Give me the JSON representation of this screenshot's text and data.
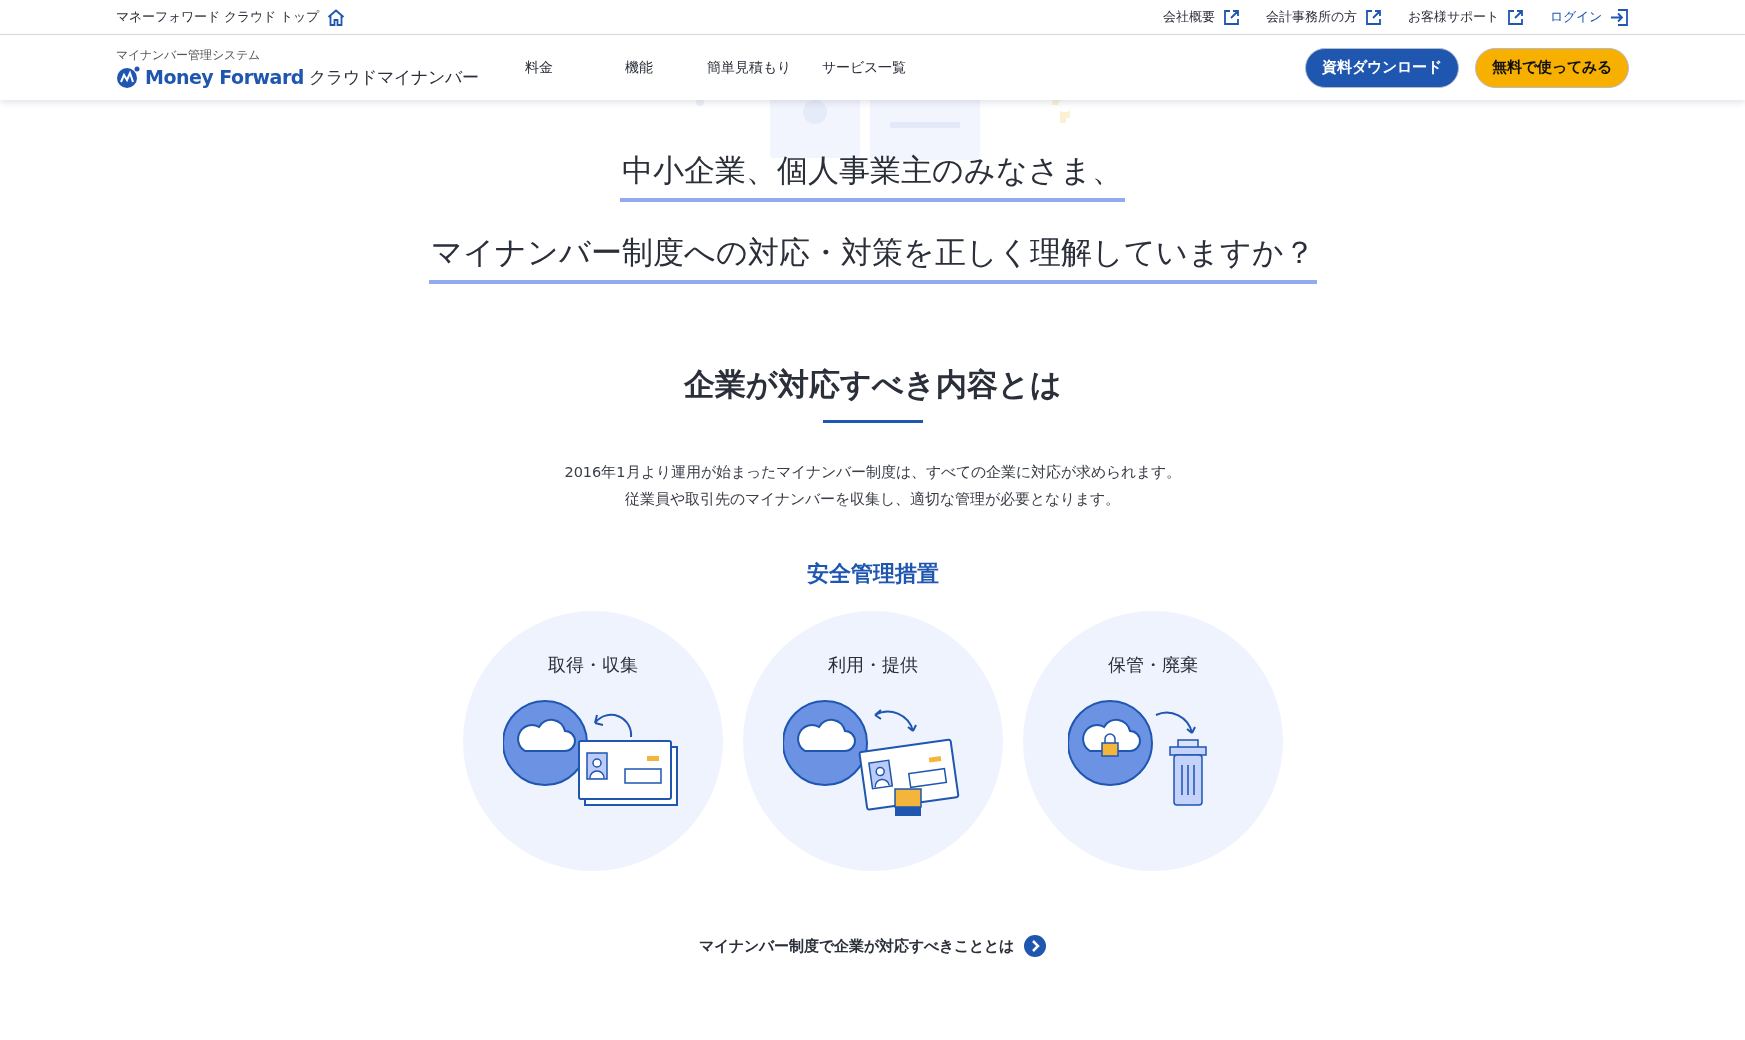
{
  "top_bar": {
    "home_link": "マネーフォワード クラウド トップ",
    "links": [
      {
        "label": "会社概要",
        "kind": "external"
      },
      {
        "label": "会計事務所の方",
        "kind": "external"
      },
      {
        "label": "お客様サポート",
        "kind": "external"
      },
      {
        "label": "ログイン",
        "kind": "login"
      }
    ]
  },
  "header": {
    "logo_tagline": "マイナンバー管理システム",
    "logo_brand": "Money Forward",
    "logo_product": "クラウドマイナンバー",
    "nav": [
      "料金",
      "機能",
      "簡単見積もり",
      "サービス一覧"
    ],
    "buttons": [
      {
        "label": "資料ダウンロード",
        "kind": "primary"
      },
      {
        "label": "無料で使ってみる",
        "kind": "accent"
      }
    ]
  },
  "hero": {
    "lines": [
      "中小企業、個人事業主のみなさま、",
      "マイナンバー制度への対応・対策を正しく理解していますか？"
    ]
  },
  "section": {
    "title": "企業が対応すべき内容とは",
    "paragraphs": [
      "2016年1月より運用が始まったマイナンバー制度は、すべての企業に対応が求められます。",
      "従業員や取引先のマイナンバーを収集し、適切な管理が必要となります。"
    ],
    "subtitle": "安全管理措置",
    "measures": [
      {
        "label": "取得・収集",
        "kind": "collect"
      },
      {
        "label": "利用・提供",
        "kind": "use"
      },
      {
        "label": "保管・廃棄",
        "kind": "dispose"
      }
    ],
    "more_link": "マイナンバー制度で企業が対応すべきこととは"
  }
}
